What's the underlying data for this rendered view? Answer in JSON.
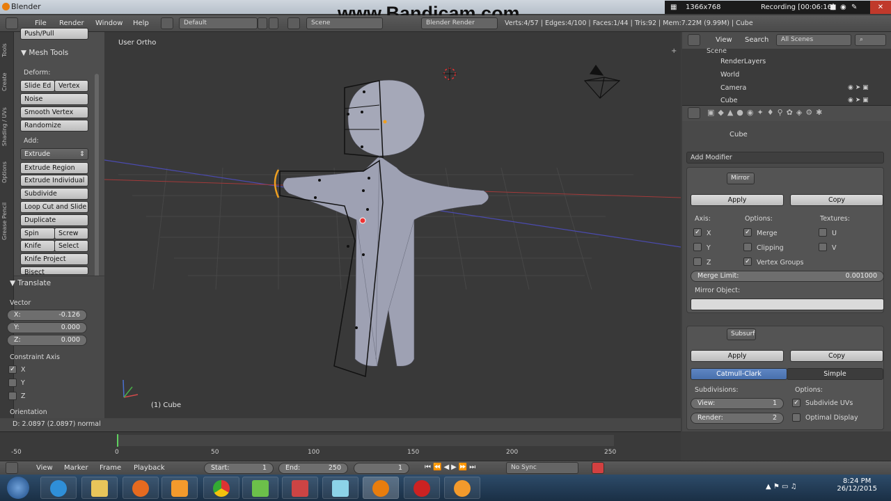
{
  "window": {
    "title": "Blender"
  },
  "recorder": {
    "watermark": "www.Bandicam.com",
    "resolution": "1366x768",
    "status": "Recording [00:06:16]"
  },
  "header": {
    "menus": [
      "File",
      "Render",
      "Window",
      "Help"
    ],
    "layout": "Default",
    "scene": "Scene",
    "engine": "Blender Render",
    "stats": "Verts:4/57 | Edges:4/100 | Faces:1/44 | Tris:92 | Mem:7.22M (9.99M) | Cube"
  },
  "side_tabs": [
    "Tools",
    "Create",
    "Shading / UVs",
    "Options",
    "Grease Pencil"
  ],
  "toolshelf": {
    "top_cut": "Push/Pull",
    "mesh_tools": "Mesh Tools",
    "deform_label": "Deform:",
    "deform": {
      "slide_edge": "Slide Ed",
      "vertex": "Vertex",
      "noise": "Noise",
      "smooth_vertex": "Smooth Vertex",
      "randomize": "Randomize"
    },
    "add_label": "Add:",
    "extrude": "Extrude",
    "extrude_region": "Extrude Region",
    "extrude_individual": "Extrude Individual",
    "subdivide": "Subdivide",
    "loop_cut": "Loop Cut and Slide",
    "duplicate": "Duplicate",
    "spin": "Spin",
    "screw": "Screw",
    "knife": "Knife",
    "select": "Select",
    "knife_project": "Knife Project",
    "bisect": "Bisect"
  },
  "translate": {
    "title": "Translate",
    "vector_label": "Vector",
    "x_label": "X:",
    "x": "-0.126",
    "y_label": "Y:",
    "y": "0.000",
    "z_label": "Z:",
    "z": "0.000",
    "constraint_label": "Constraint Axis",
    "cx": "X",
    "cy": "Y",
    "cz": "Z",
    "orientation_label": "Orientation"
  },
  "viewport": {
    "view_name": "User Ortho",
    "object_name": "(1) Cube"
  },
  "statusline": "D: 2.0897 (2.0897) normal",
  "outliner": {
    "view": "View",
    "search": "Search",
    "scenes": "All Scenes",
    "items": [
      "Scene",
      "RenderLayers",
      "World",
      "Camera",
      "Cube"
    ]
  },
  "properties": {
    "object": "Cube",
    "add_modifier": "Add Modifier",
    "mirror": {
      "name": "Mirror",
      "apply": "Apply",
      "copy": "Copy",
      "axis_label": "Axis:",
      "options_label": "Options:",
      "textures_label": "Textures:",
      "x": "X",
      "y": "Y",
      "z": "Z",
      "merge": "Merge",
      "clipping": "Clipping",
      "vertex_groups": "Vertex Groups",
      "u": "U",
      "v": "V",
      "merge_limit_label": "Merge Limit:",
      "merge_limit": "0.001000",
      "mirror_object_label": "Mirror Object:"
    },
    "subsurf": {
      "name": "Subsurf",
      "apply": "Apply",
      "copy": "Copy",
      "catmull": "Catmull-Clark",
      "simple": "Simple",
      "subdivisions_label": "Subdivisions:",
      "options_label": "Options:",
      "view_label": "View:",
      "view": "1",
      "render_label": "Render:",
      "render": "2",
      "subdivide_uvs": "Subdivide UVs",
      "optimal_display": "Optimal Display"
    }
  },
  "timeline": {
    "ticks": [
      "-50",
      "0",
      "50",
      "100",
      "150",
      "200",
      "250"
    ],
    "menus": [
      "View",
      "Marker",
      "Frame",
      "Playback"
    ],
    "start_label": "Start:",
    "start": "1",
    "end_label": "End:",
    "end": "250",
    "current": "1",
    "sync": "No Sync"
  },
  "taskbar": {
    "time": "8:24 PM",
    "date": "26/12/2015"
  },
  "colors": {
    "accent": "#5680c2",
    "header": "#4f4f4f",
    "viewport": "#393939",
    "taskbar": "#1f3a56"
  }
}
